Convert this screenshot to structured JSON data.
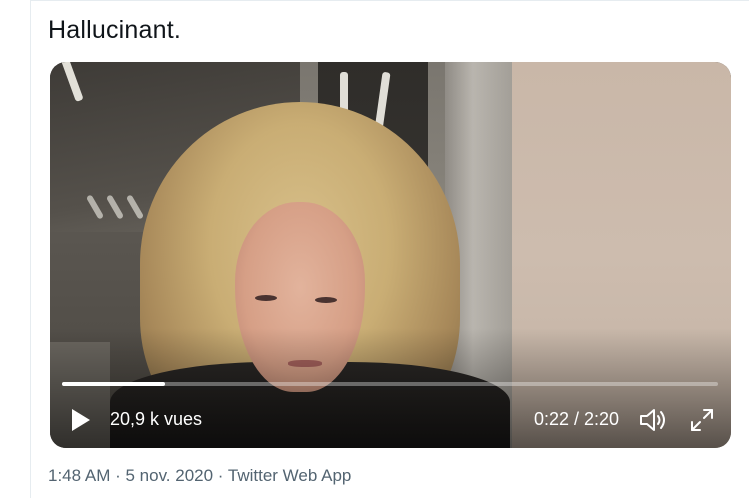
{
  "tweet": {
    "text": "Hallucinant."
  },
  "video": {
    "views": "20,9 k vues",
    "time": "0:22 / 2:20",
    "progress_fraction": 0.157,
    "play_icon": "play-icon",
    "volume_icon": "volume-icon",
    "fullscreen_icon": "fullscreen-icon"
  },
  "meta": {
    "time": "1:48 AM",
    "sep1": " · ",
    "date": "5 nov. 2020",
    "sep2": " · ",
    "source": "Twitter Web App"
  }
}
